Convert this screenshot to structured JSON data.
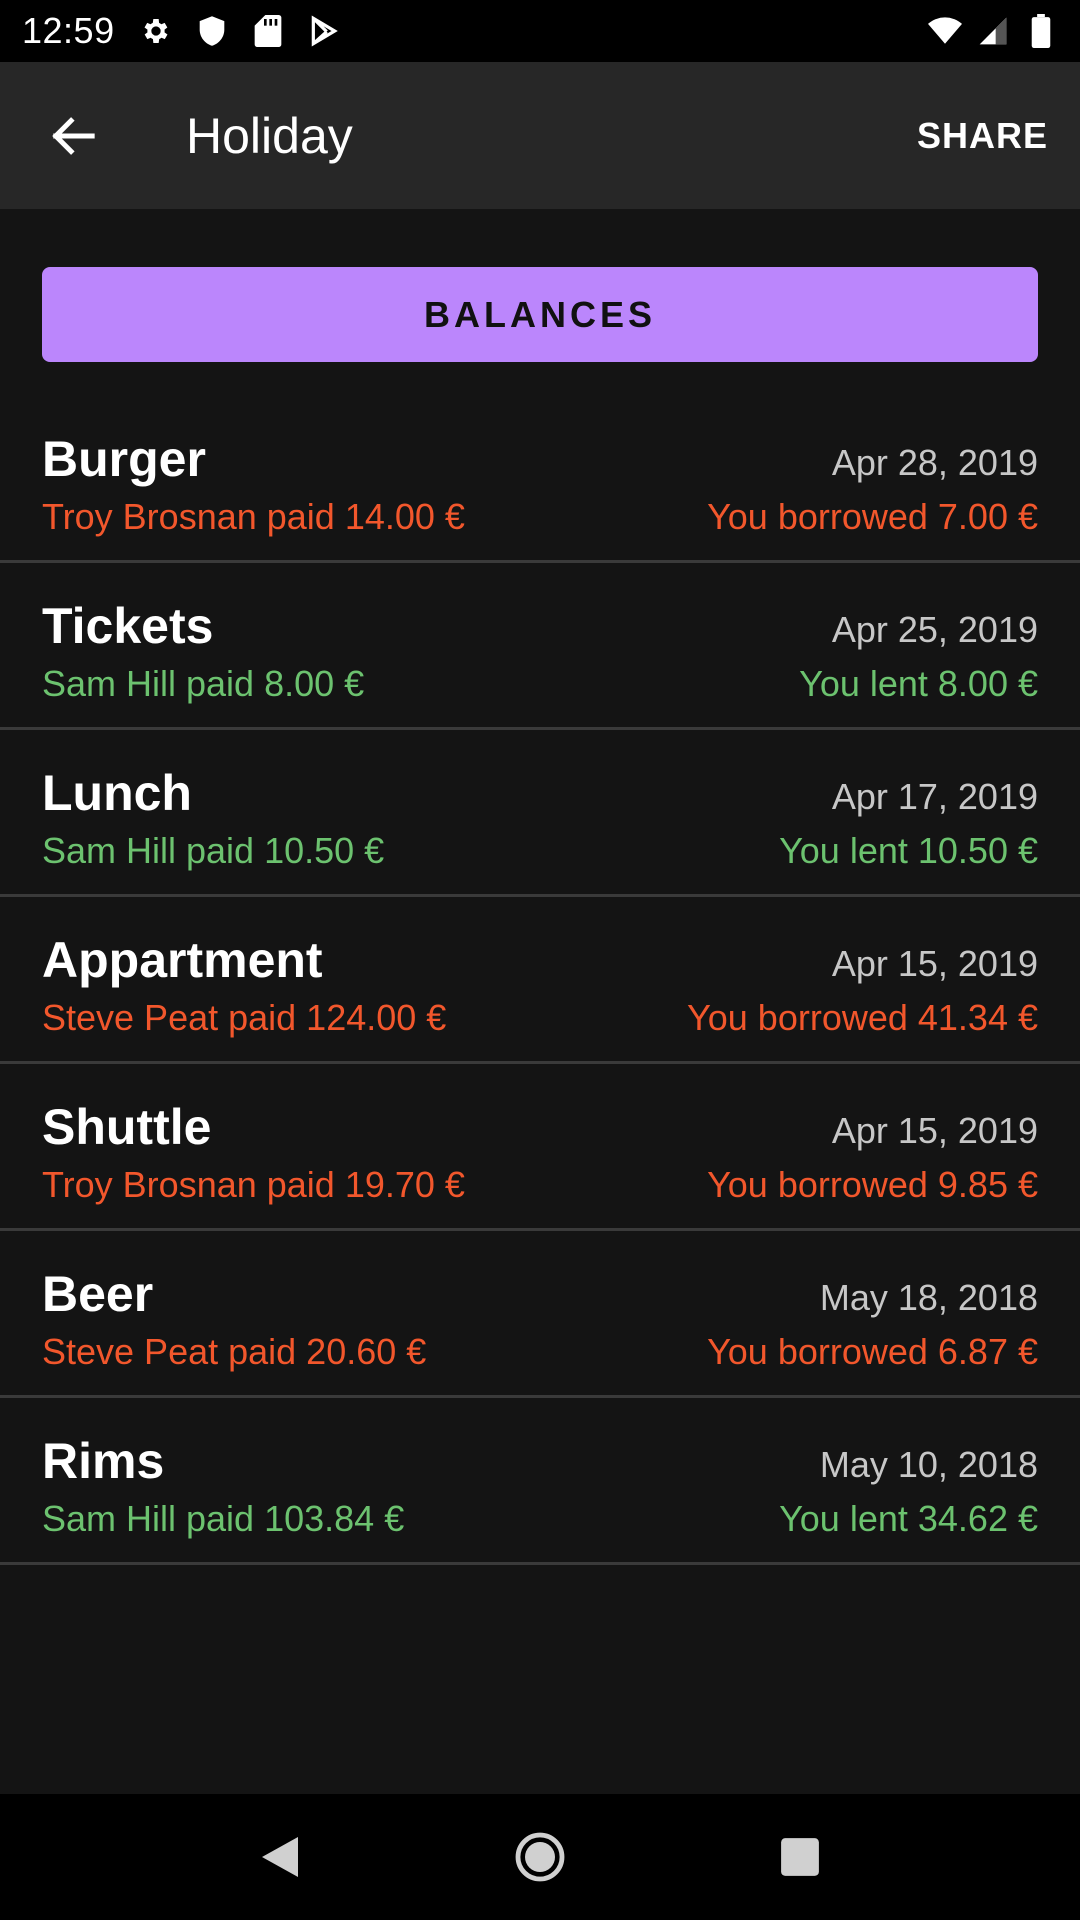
{
  "status_bar": {
    "time": "12:59",
    "left_icons": [
      "settings-icon",
      "shield-icon",
      "sd-card-icon",
      "play-store-icon"
    ],
    "right_icons": [
      "wifi-icon",
      "signal-icon",
      "battery-icon"
    ]
  },
  "app_bar": {
    "back_icon": "arrow-left-icon",
    "title": "Holiday",
    "share_label": "SHARE"
  },
  "balances_label": "BALANCES",
  "colors": {
    "accent": "#bb86fc",
    "negative": "#f2572c",
    "positive": "#6cc26f"
  },
  "expenses": [
    {
      "title": "Burger",
      "date": "Apr 28, 2019",
      "paid": "Troy Brosnan paid 14.00 €",
      "share": "You borrowed 7.00 €",
      "status": "negative"
    },
    {
      "title": "Tickets",
      "date": "Apr 25, 2019",
      "paid": "Sam Hill paid 8.00 €",
      "share": "You lent 8.00 €",
      "status": "positive"
    },
    {
      "title": "Lunch",
      "date": "Apr 17, 2019",
      "paid": "Sam Hill paid 10.50 €",
      "share": "You lent 10.50 €",
      "status": "positive"
    },
    {
      "title": "Appartment",
      "date": "Apr 15, 2019",
      "paid": "Steve Peat paid 124.00 €",
      "share": "You borrowed 41.34 €",
      "status": "negative"
    },
    {
      "title": "Shuttle",
      "date": "Apr 15, 2019",
      "paid": "Troy Brosnan paid 19.70 €",
      "share": "You borrowed 9.85 €",
      "status": "negative"
    },
    {
      "title": "Beer",
      "date": "May 18, 2018",
      "paid": "Steve Peat paid 20.60 €",
      "share": "You borrowed 6.87 €",
      "status": "negative"
    },
    {
      "title": "Rims",
      "date": "May 10, 2018",
      "paid": "Sam Hill paid 103.84 €",
      "share": "You lent 34.62 €",
      "status": "positive"
    }
  ],
  "nav_bar": {
    "back_icon": "nav-back-icon",
    "home_icon": "nav-home-icon",
    "recents_icon": "nav-recents-icon"
  }
}
